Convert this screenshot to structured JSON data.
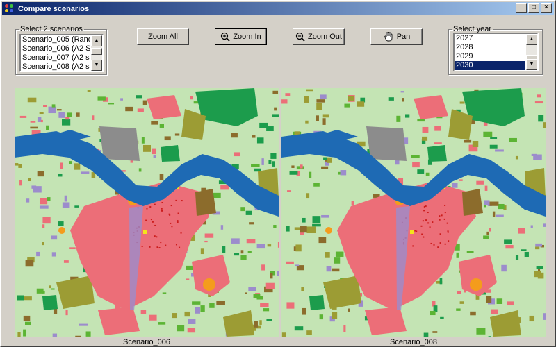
{
  "window": {
    "title": "Compare scenarios",
    "min": "_",
    "max": "□",
    "close": "×"
  },
  "scenario_group": {
    "legend": "Select 2 scenarios",
    "items": [
      "Scenario_005 (Rand",
      "Scenario_006 (A2 Sc",
      "Scenario_007 (A2 sc",
      "Scenario_008 (A2 sc"
    ]
  },
  "toolbar": {
    "zoom_all": "Zoom All",
    "zoom_in": "Zoom In",
    "zoom_out": "Zoom Out",
    "pan": "Pan"
  },
  "year_group": {
    "legend": "Select year",
    "items": [
      "2027",
      "2028",
      "2029",
      "2030"
    ],
    "selected": "2030"
  },
  "maps": {
    "left_label": "Scenario_006",
    "right_label": "Scenario_008"
  },
  "colors": {
    "background": "#c4e4b4",
    "water": "#1e6ab4",
    "urban": "#ec6e78",
    "industry": "#8c8c8c",
    "forest": "#1c9c4c",
    "agriculture": "#9c9c34",
    "grass": "#5cb434",
    "brown": "#8c6c2c",
    "orange": "#f49c1c",
    "yellow": "#f4e41c",
    "red": "#cc1c1c",
    "infrastructure": "#9c8ccc"
  }
}
